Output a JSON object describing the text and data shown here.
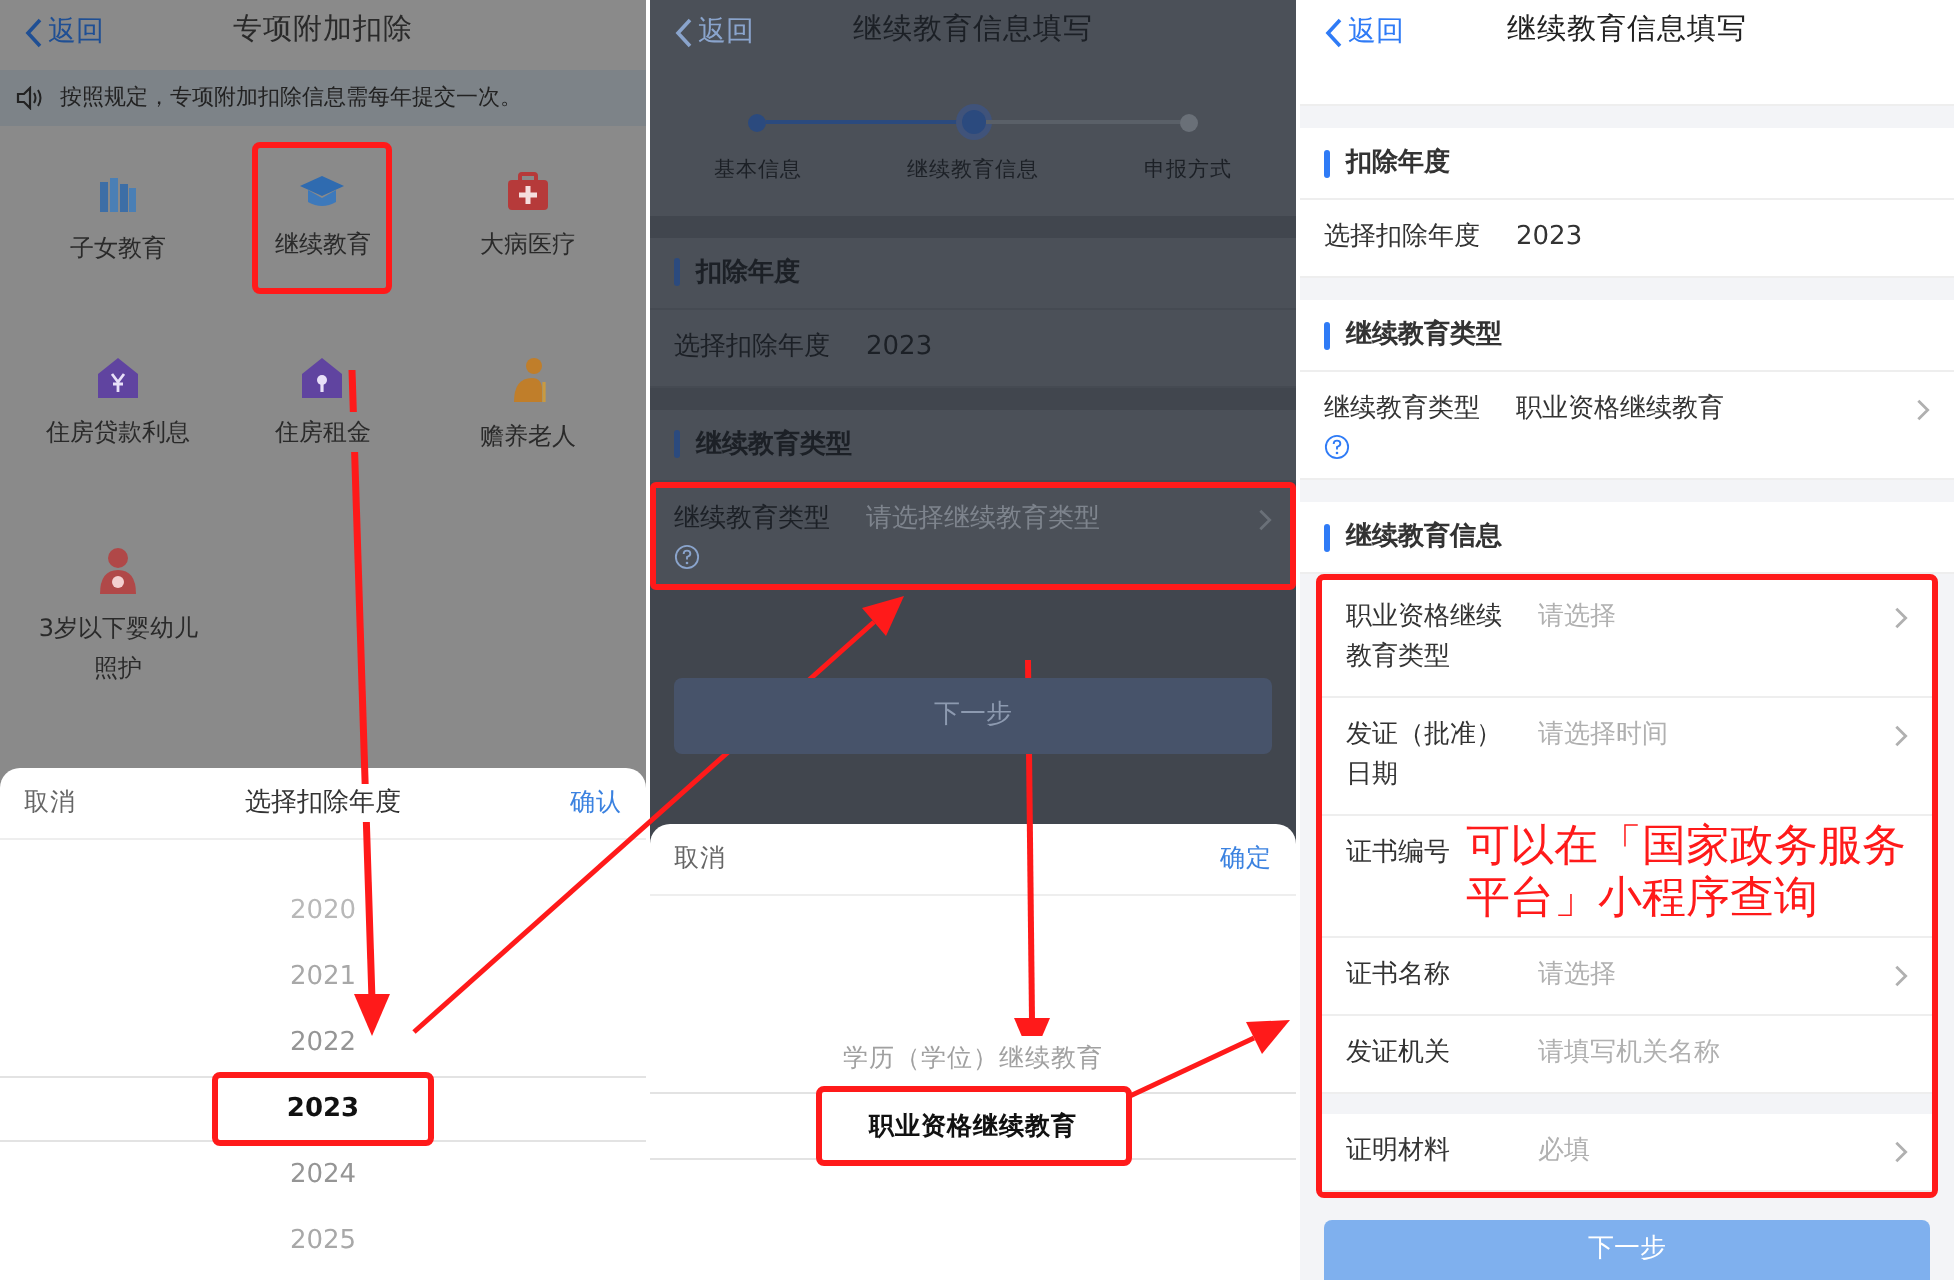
{
  "left_screen": {
    "nav": {
      "back": "返回",
      "title": "专项附加扣除"
    },
    "notice": "按照规定，专项附加扣除信息需每年提交一次。",
    "categories": [
      {
        "label": "子女教育",
        "kind": "books",
        "highlighted": false
      },
      {
        "label": "继续教育",
        "kind": "cap",
        "highlighted": true
      },
      {
        "label": "大病医疗",
        "kind": "kit",
        "highlighted": false
      },
      {
        "label": "住房贷款利息",
        "kind": "house_yen",
        "highlighted": false
      },
      {
        "label": "住房租金",
        "kind": "house_key",
        "highlighted": false
      },
      {
        "label": "赡养老人",
        "kind": "elder",
        "highlighted": false
      },
      {
        "label": "3岁以下婴幼儿照护",
        "kind": "mother",
        "highlighted": false
      }
    ],
    "picker": {
      "cancel": "取消",
      "title": "选择扣除年度",
      "confirm": "确认",
      "options": [
        {
          "label": "2020",
          "selected": false,
          "highlighted": false
        },
        {
          "label": "2021",
          "selected": false,
          "highlighted": false
        },
        {
          "label": "2022",
          "selected": false,
          "highlighted": false
        },
        {
          "label": "2023",
          "selected": true,
          "highlighted": true
        },
        {
          "label": "2024",
          "selected": false,
          "highlighted": false
        },
        {
          "label": "2025",
          "selected": false,
          "highlighted": false
        }
      ]
    }
  },
  "middle_screen": {
    "nav": {
      "back": "返回",
      "title": "继续教育信息填写"
    },
    "steps": [
      {
        "label": "基本信息",
        "completed": true,
        "current": false
      },
      {
        "label": "继续教育信息",
        "completed": false,
        "current": true
      },
      {
        "label": "申报方式",
        "completed": false,
        "current": false
      }
    ],
    "sections": [
      {
        "title": "扣除年度",
        "rows": [
          {
            "label": "选择扣除年度",
            "value": "2023"
          }
        ]
      },
      {
        "title": "继续教育类型",
        "rows": [
          {
            "label": "继续教育类型",
            "placeholder": "请选择继续教育类型",
            "help": true,
            "chevron": true,
            "highlighted": true
          }
        ]
      }
    ],
    "next_button": "下一步",
    "picker": {
      "cancel": "取消",
      "confirm": "确定",
      "options": [
        {
          "label": "学历（学位）继续教育",
          "selected": false,
          "highlighted": false
        },
        {
          "label": "职业资格继续教育",
          "selected": true,
          "highlighted": true
        }
      ]
    }
  },
  "right_screen": {
    "nav": {
      "back": "返回",
      "title": "继续教育信息填写"
    },
    "sections": [
      {
        "title": "扣除年度",
        "rows": [
          {
            "label": "选择扣除年度",
            "value": "2023"
          }
        ]
      },
      {
        "title": "继续教育类型",
        "rows": [
          {
            "label": "继续教育类型",
            "value": "职业资格继续教育",
            "help": true,
            "chevron": true
          }
        ]
      },
      {
        "title": "继续教育信息",
        "highlighted": true,
        "rows": [
          {
            "label": "职业资格继续教育类型",
            "placeholder": "请选择",
            "chevron": true
          },
          {
            "label": "发证（批准）日期",
            "placeholder": "请选择时间",
            "chevron": true
          },
          {
            "label": "证书编号",
            "note": "可以在「国家政务服务平台」小程序查询"
          },
          {
            "label": "证书名称",
            "placeholder": "请选择",
            "chevron": true
          },
          {
            "label": "发证机关",
            "placeholder": "请填写机关名称"
          },
          {
            "label": "证明材料",
            "placeholder": "必填",
            "chevron": true,
            "break_before": true
          }
        ]
      }
    ],
    "next_button": "下一步"
  }
}
